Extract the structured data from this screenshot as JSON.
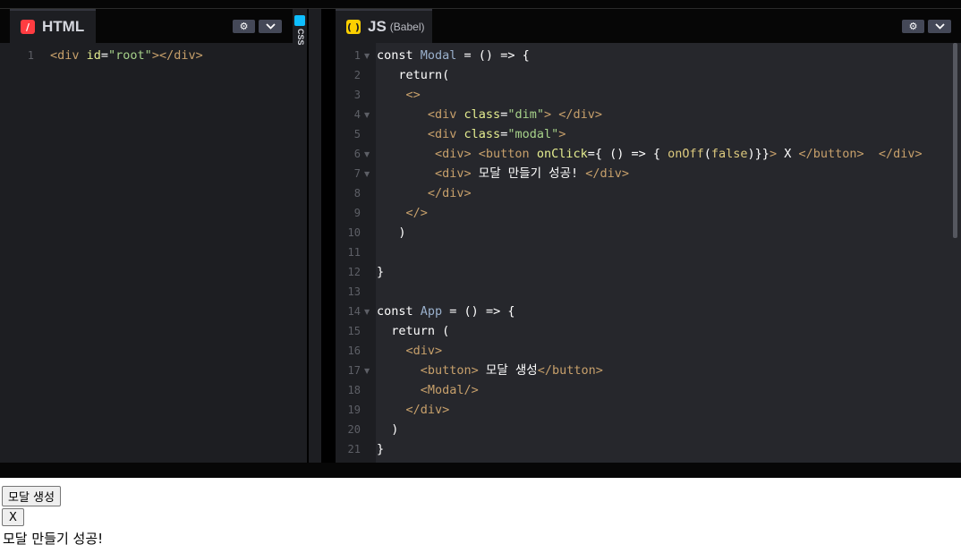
{
  "html_panel": {
    "title": "HTML",
    "settings_icon": "gear-icon",
    "collapse_icon": "chevron-down-icon",
    "lines": [
      {
        "n": "1",
        "tokens": [
          [
            "tag",
            "<div "
          ],
          [
            "attr",
            "id"
          ],
          [
            "kw",
            "="
          ],
          [
            "str",
            "\"root\""
          ],
          [
            "tag",
            "></div>"
          ]
        ]
      }
    ]
  },
  "css_panel": {
    "title": "CSS"
  },
  "js_panel": {
    "title": "JS",
    "subtitle": "(Babel)",
    "settings_icon": "gear-icon",
    "collapse_icon": "chevron-down-icon",
    "lines": [
      {
        "n": "1",
        "fold": true,
        "tokens": [
          [
            "kw",
            "const "
          ],
          [
            "fn",
            "Modal"
          ],
          [
            "kw",
            " = () => {"
          ]
        ]
      },
      {
        "n": "2",
        "tokens": [
          [
            "kw",
            "   return("
          ]
        ]
      },
      {
        "n": "3",
        "tokens": [
          [
            "tag",
            "    <>"
          ]
        ]
      },
      {
        "n": "4",
        "fold": true,
        "tokens": [
          [
            "tag",
            "       <div "
          ],
          [
            "attr",
            "class"
          ],
          [
            "kw",
            "="
          ],
          [
            "str",
            "\"dim\""
          ],
          [
            "tag",
            "> </div>"
          ]
        ]
      },
      {
        "n": "5",
        "tokens": [
          [
            "tag",
            "       <div "
          ],
          [
            "attr",
            "class"
          ],
          [
            "kw",
            "="
          ],
          [
            "str",
            "\"modal\""
          ],
          [
            "tag",
            ">"
          ]
        ]
      },
      {
        "n": "6",
        "fold": true,
        "tokens": [
          [
            "tag",
            "        <div> <button "
          ],
          [
            "attr",
            "onClick"
          ],
          [
            "kw",
            "={ () => { "
          ],
          [
            "fnc",
            "onOff"
          ],
          [
            "kw",
            "("
          ],
          [
            "bool",
            "false"
          ],
          [
            "kw",
            ")}}"
          ],
          [
            "tag",
            "> "
          ],
          [
            "kw",
            "X "
          ],
          [
            "tag",
            "</button>  </div>"
          ]
        ]
      },
      {
        "n": "7",
        "fold": true,
        "tokens": [
          [
            "tag",
            "        <div> "
          ],
          [
            "kw",
            "모달 만들기 성공! "
          ],
          [
            "tag",
            "</div>"
          ]
        ]
      },
      {
        "n": "8",
        "tokens": [
          [
            "tag",
            "       </div>"
          ]
        ]
      },
      {
        "n": "9",
        "tokens": [
          [
            "tag",
            "    </>"
          ]
        ]
      },
      {
        "n": "10",
        "tokens": [
          [
            "kw",
            "   )"
          ]
        ]
      },
      {
        "n": "11",
        "tokens": []
      },
      {
        "n": "12",
        "tokens": [
          [
            "kw",
            "}"
          ]
        ]
      },
      {
        "n": "13",
        "tokens": []
      },
      {
        "n": "14",
        "fold": true,
        "tokens": [
          [
            "kw",
            "const "
          ],
          [
            "fn",
            "App"
          ],
          [
            "kw",
            " = () => {"
          ]
        ]
      },
      {
        "n": "15",
        "tokens": [
          [
            "kw",
            "  return ("
          ]
        ]
      },
      {
        "n": "16",
        "tokens": [
          [
            "tag",
            "    <div>"
          ]
        ]
      },
      {
        "n": "17",
        "fold": true,
        "tokens": [
          [
            "tag",
            "      <button> "
          ],
          [
            "kw",
            "모달 생성"
          ],
          [
            "tag",
            "</button>"
          ]
        ]
      },
      {
        "n": "18",
        "tokens": [
          [
            "tag",
            "      <Modal/>"
          ]
        ]
      },
      {
        "n": "19",
        "tokens": [
          [
            "tag",
            "    </div>"
          ]
        ]
      },
      {
        "n": "20",
        "tokens": [
          [
            "kw",
            "  )"
          ]
        ]
      },
      {
        "n": "21",
        "tokens": [
          [
            "kw",
            "}"
          ]
        ]
      }
    ]
  },
  "preview": {
    "create_button": "모달 생성",
    "close_button": "X",
    "success_text": "모달 만들기 성공!"
  }
}
